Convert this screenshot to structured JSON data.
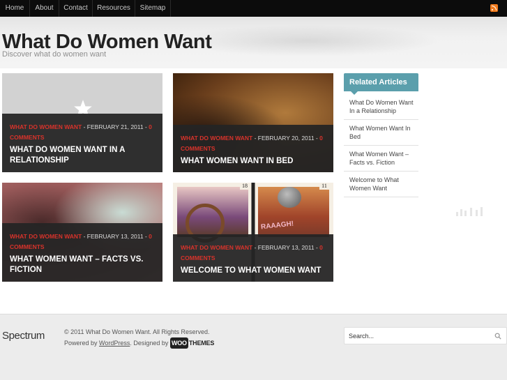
{
  "nav": {
    "items": [
      {
        "label": "Home"
      },
      {
        "label": "About"
      },
      {
        "label": "Contact"
      },
      {
        "label": "Resources"
      },
      {
        "label": "Sitemap"
      }
    ],
    "rss_icon": "rss-icon"
  },
  "header": {
    "title": "What Do Women Want",
    "description": "Discover what do women want"
  },
  "posts": [
    {
      "category": "WHAT DO WOMEN WANT",
      "date": " - FEBRUARY 21, 2011 - ",
      "comments": "0 COMMENTS",
      "title": "WHAT DO WOMEN WANT IN A RELATIONSHIP"
    },
    {
      "category": "WHAT DO WOMEN WANT",
      "date": " - FEBRUARY 20, 2011 - ",
      "comments": "0 COMMENTS",
      "title": "WHAT WOMEN WANT IN BED"
    },
    {
      "category": "WHAT DO WOMEN WANT",
      "date": " - FEBRUARY 13, 2011 - ",
      "comments": "0 COMMENTS",
      "title": "WHAT WOMEN WANT – FACTS VS. FICTION"
    },
    {
      "category": "WHAT DO WOMEN WANT",
      "date": " - FEBRUARY 13, 2011 - ",
      "comments": "0 COMMENTS",
      "title": "WELCOME TO WHAT WOMEN WANT"
    }
  ],
  "post_images": {
    "comic_numbers": [
      "18",
      "11"
    ],
    "comic_caption": "RAAAGH!"
  },
  "sidebar": {
    "heading": "Related Articles",
    "items": [
      {
        "label": "What Do Women Want In a Relationship"
      },
      {
        "label": "What Women Want In Bed"
      },
      {
        "label": "What Women Want – Facts vs. Fiction"
      },
      {
        "label": "Welcome to What Women Want"
      }
    ]
  },
  "footer": {
    "logo": "Spectrum",
    "copyright": "© 2011 What Do Women Want. All Rights Reserved.",
    "powered_by_prefix": "Powered by ",
    "powered_by_link": "WordPress",
    "designed_by_prefix": ". Designed by ",
    "woo_left": "WOO",
    "woo_right": "THEMES"
  },
  "search": {
    "placeholder": "Search...",
    "icon": "search-icon"
  },
  "colors": {
    "nav_bg": "#0c0c0c",
    "accent_red": "#d8332b",
    "sidebar_head": "#5b9fac",
    "rss": "#f07a1c"
  }
}
